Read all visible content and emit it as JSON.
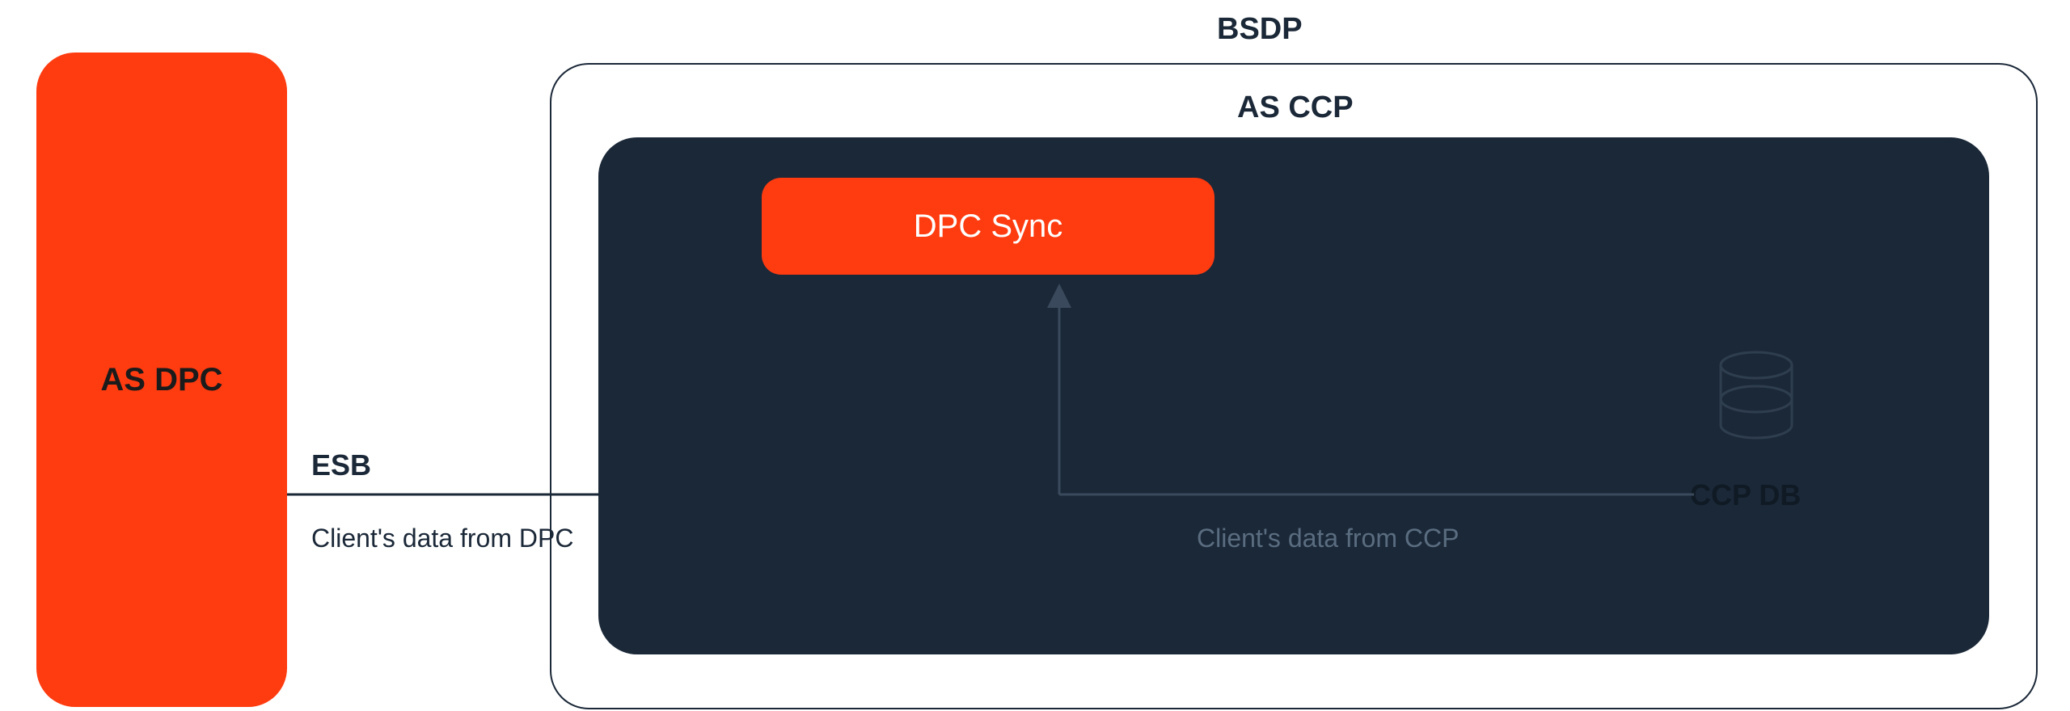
{
  "labels": {
    "as_dpc": "AS DPC",
    "bsdp": "BSDP",
    "as_ccp": "AS CCP",
    "dpc_sync": "DPC Sync",
    "esb": "ESB",
    "ccp_db": "CCP DB",
    "client_data_dpc": "Client's data from DPC",
    "client_data_ccp": "Client's data from CCP"
  },
  "colors": {
    "accent": "#ff3b10",
    "navy": "#1b2838",
    "text_dark": "#1b2838",
    "text_on_accent_dark": "#1b1b1b",
    "text_on_accent_light": "#ffffff",
    "caption_dim": "#7b8da0"
  },
  "diagram": {
    "nodes": [
      {
        "id": "as_dpc",
        "kind": "system",
        "label_key": "as_dpc"
      },
      {
        "id": "bsdp",
        "kind": "boundary",
        "label_key": "bsdp"
      },
      {
        "id": "as_ccp",
        "kind": "system",
        "label_key": "as_ccp",
        "parent": "bsdp"
      },
      {
        "id": "dpc_sync",
        "kind": "component",
        "label_key": "dpc_sync",
        "parent": "as_ccp"
      },
      {
        "id": "ccp_db",
        "kind": "database",
        "label_key": "ccp_db",
        "parent": "as_ccp"
      },
      {
        "id": "esb",
        "kind": "bus",
        "label_key": "esb"
      }
    ],
    "edges": [
      {
        "from": "as_dpc",
        "to": "dpc_sync",
        "via": "esb",
        "label_key": "client_data_dpc"
      },
      {
        "from": "ccp_db",
        "to": "dpc_sync",
        "via": "esb",
        "label_key": "client_data_ccp"
      }
    ]
  }
}
